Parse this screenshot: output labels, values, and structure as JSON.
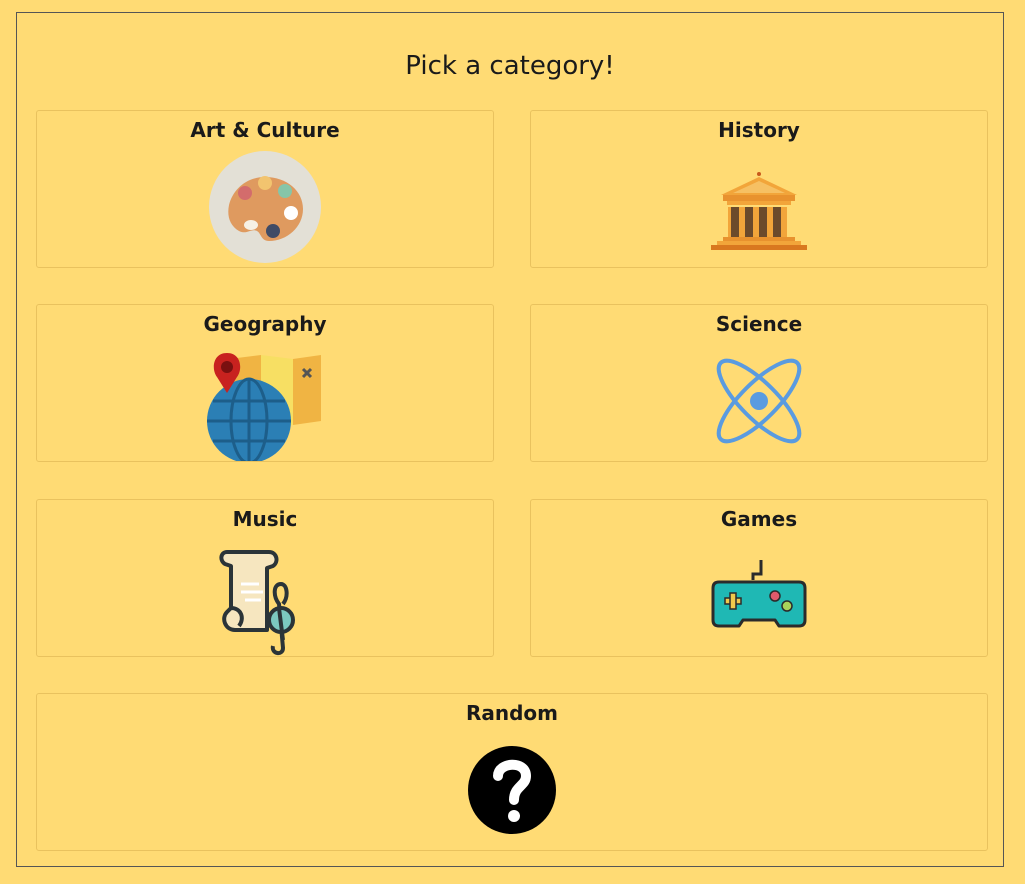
{
  "page": {
    "title": "Pick a category!"
  },
  "categories": [
    {
      "label": "Art & Culture",
      "icon": "palette-icon"
    },
    {
      "label": "History",
      "icon": "museum-building-icon"
    },
    {
      "label": "Geography",
      "icon": "globe-map-icon"
    },
    {
      "label": "Science",
      "icon": "atom-icon"
    },
    {
      "label": "Music",
      "icon": "music-scroll-icon"
    },
    {
      "label": "Games",
      "icon": "gamepad-icon"
    },
    {
      "label": "Random",
      "icon": "question-mark-icon"
    }
  ],
  "colors": {
    "background": "#ffdb74",
    "card_border": "#e9c25e",
    "text": "#1a1a1a"
  }
}
